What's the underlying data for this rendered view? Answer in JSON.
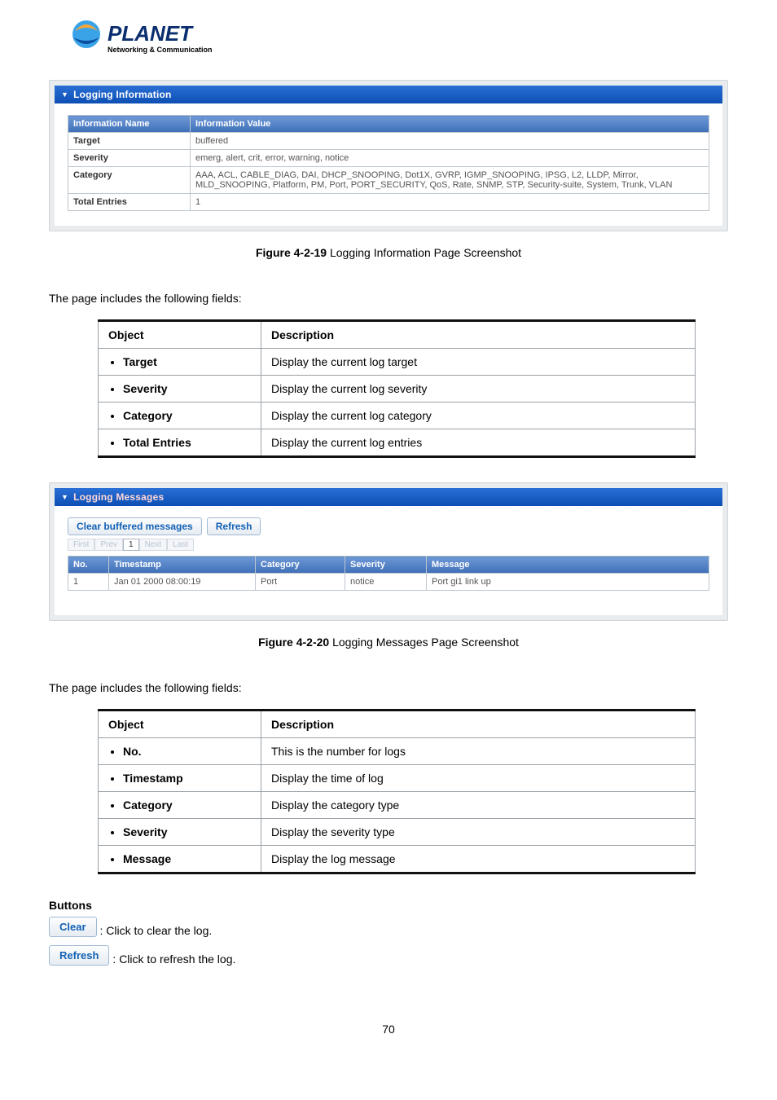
{
  "logo": {
    "brand": "PLANET",
    "tagline": "Networking & Communication"
  },
  "logging_info": {
    "section_title": "Logging Information",
    "header_name": "Information Name",
    "header_value": "Information Value",
    "rows": [
      {
        "name": "Target",
        "value": "buffered"
      },
      {
        "name": "Severity",
        "value": "emerg, alert, crit, error, warning, notice"
      },
      {
        "name": "Category",
        "value": "AAA, ACL, CABLE_DIAG, DAI, DHCP_SNOOPING, Dot1X, GVRP, IGMP_SNOOPING, IPSG, L2, LLDP, Mirror, MLD_SNOOPING, Platform, PM, Port, PORT_SECURITY, QoS, Rate, SNMP, STP, Security-suite, System, Trunk, VLAN"
      },
      {
        "name": "Total Entries",
        "value": "1"
      }
    ],
    "caption_bold": "Figure 4-2-19",
    "caption_rest": " Logging Information Page Screenshot"
  },
  "fields_intro": "The page includes the following fields:",
  "doc_table1": {
    "h_object": "Object",
    "h_desc": "Description",
    "rows": [
      {
        "obj": "Target",
        "desc": "Display the current log target"
      },
      {
        "obj": "Severity",
        "desc": "Display the current log severity"
      },
      {
        "obj": "Category",
        "desc": "Display the current log category"
      },
      {
        "obj": "Total Entries",
        "desc": "Display the current log entries"
      }
    ]
  },
  "logging_msgs": {
    "section_title": "Logging Messages",
    "btn_clear": "Clear buffered messages",
    "btn_refresh": "Refresh",
    "pager": {
      "first": "First",
      "prev": "Prev",
      "current": "1",
      "next": "Next",
      "last": "Last"
    },
    "cols": {
      "no": "No.",
      "ts": "Timestamp",
      "cat": "Category",
      "sev": "Severity",
      "msg": "Message"
    },
    "rows": [
      {
        "no": "1",
        "ts": "Jan 01 2000 08:00:19",
        "cat": "Port",
        "sev": "notice",
        "msg": "Port gi1 link up"
      }
    ],
    "caption_bold": "Figure 4-2-20",
    "caption_rest": " Logging Messages Page Screenshot"
  },
  "doc_table2": {
    "h_object": "Object",
    "h_desc": "Description",
    "rows": [
      {
        "obj": "No.",
        "desc": "This is the number for logs"
      },
      {
        "obj": "Timestamp",
        "desc": "Display the time of log"
      },
      {
        "obj": "Category",
        "desc": "Display the category type"
      },
      {
        "obj": "Severity",
        "desc": "Display the severity type"
      },
      {
        "obj": "Message",
        "desc": "Display the log message"
      }
    ]
  },
  "buttons_sect": {
    "heading": "Buttons",
    "clear_label": "Clear",
    "clear_desc": ": Click to clear the log.",
    "refresh_label": "Refresh",
    "refresh_desc": ": Click to refresh the log."
  },
  "page_number": "70"
}
